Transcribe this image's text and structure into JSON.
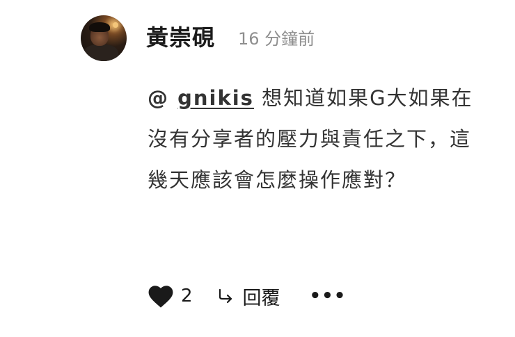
{
  "comment": {
    "username": "黃崇硯",
    "timestamp": "16 分鐘前",
    "mention_prefix": "@ ",
    "mention_handle": "gnikis",
    "text": " 想知道如果G大如果在沒有分享者的壓力與責任之下，這幾天應該會怎麼操作應對？",
    "like_count": "2",
    "reply_label": "回覆",
    "more_label": "•••"
  },
  "icons": {
    "like": "heart-icon",
    "reply": "reply-arrow-icon",
    "more": "more-options-icon"
  },
  "colors": {
    "text": "#333333",
    "timestamp": "#8e8e8e",
    "heart": "#1a1a1a"
  }
}
